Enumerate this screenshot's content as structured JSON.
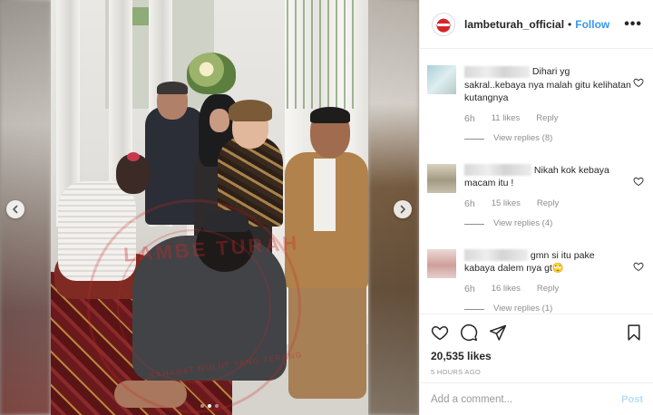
{
  "post": {
    "username": "lambeturah_official",
    "separator": "•",
    "follow_label": "Follow",
    "more_label": "•••",
    "image": {
      "slide_count": 3,
      "active_slide": 1,
      "watermark_text": "LAMBE TURAH",
      "watermark_sub": "SAHABAT MULUT YANG TERANG"
    }
  },
  "comments": [
    {
      "text_lead": "Dihari yg",
      "text": "sakral..kebaya nya malah gitu kelihatan kutangnya",
      "time": "6h",
      "likes": "11 likes",
      "reply_label": "Reply",
      "view_replies": "View replies (8)",
      "avatar_color": "#b8d4d8"
    },
    {
      "text_lead": "Nikah kok kebaya",
      "text": "macam itu !",
      "time": "6h",
      "likes": "15 likes",
      "reply_label": "Reply",
      "view_replies": "View replies (4)",
      "avatar_color": "#b9ae97"
    },
    {
      "text_lead": "gmn si itu pake",
      "text": "kabaya dalem nya gt🙄",
      "time": "6h",
      "likes": "16 likes",
      "reply_label": "Reply",
      "view_replies": "View replies (1)",
      "avatar_color": "#d7a9a6"
    }
  ],
  "likes_count": "20,535 likes",
  "time_ago": "5 HOURS AGO",
  "add_comment": {
    "placeholder": "Add a comment...",
    "post_label": "Post"
  },
  "colors": {
    "link_blue": "#3897f0",
    "post_disabled": "#b2dffc",
    "muted": "#8e8e8e"
  },
  "icons": [
    "chevron-left-icon",
    "chevron-right-icon",
    "heart-icon",
    "comment-icon",
    "share-icon",
    "bookmark-icon",
    "more-icon"
  ]
}
